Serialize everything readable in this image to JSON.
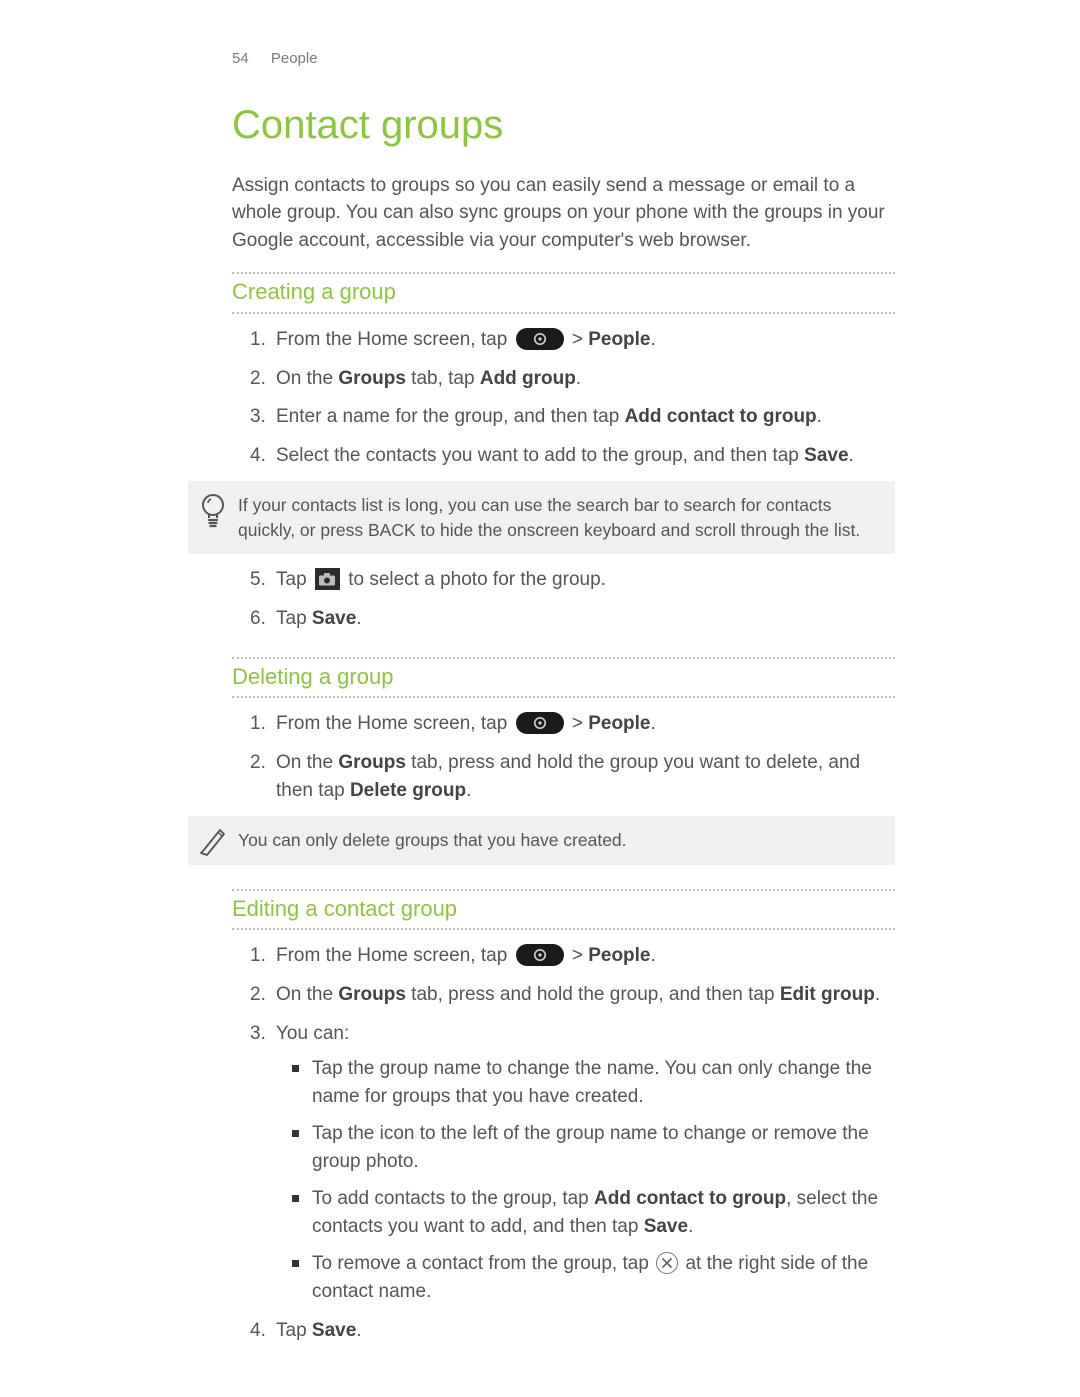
{
  "header": {
    "page_number": "54",
    "section": "People"
  },
  "title": "Contact groups",
  "intro": "Assign contacts to groups so you can easily send a message or email to a whole group. You can also sync groups on your phone with the groups in your Google account, accessible via your computer's web browser.",
  "sections": {
    "creating": {
      "heading": "Creating a group",
      "step1_a": "From the Home screen, tap ",
      "step1_b": " > ",
      "step1_people": "People",
      "step1_c": ".",
      "step2_a": "On the ",
      "step2_groups": "Groups",
      "step2_b": " tab, tap ",
      "step2_addgroup": "Add group",
      "step2_c": ".",
      "step3_a": "Enter a name for the group, and then tap ",
      "step3_add": "Add contact to group",
      "step3_b": ".",
      "step4_a": "Select the contacts you want to add to the group, and then tap ",
      "step4_save": "Save",
      "step4_b": ".",
      "tip": "If your contacts list is long, you can use the search bar to search for contacts quickly, or press BACK to hide the onscreen keyboard and scroll through the list.",
      "step5_a": "Tap ",
      "step5_b": " to select a photo for the group.",
      "step6_a": "Tap ",
      "step6_save": "Save",
      "step6_b": "."
    },
    "deleting": {
      "heading": "Deleting a group",
      "step1_a": "From the Home screen, tap ",
      "step1_b": " > ",
      "step1_people": "People",
      "step1_c": ".",
      "step2_a": "On the ",
      "step2_groups": "Groups",
      "step2_b": " tab, press and hold the group you want to delete, and then tap ",
      "step2_del": "Delete group",
      "step2_c": ".",
      "note": "You can only delete groups that you have created."
    },
    "editing": {
      "heading": "Editing a contact group",
      "step1_a": "From the Home screen, tap ",
      "step1_b": " > ",
      "step1_people": "People",
      "step1_c": ".",
      "step2_a": "On the ",
      "step2_groups": "Groups",
      "step2_b": " tab, press and hold the group, and then tap ",
      "step2_edit": "Edit group",
      "step2_c": ".",
      "step3": "You can:",
      "bullet1": "Tap the group name to change the name. You can only change the name for groups that you have created.",
      "bullet2": "Tap the icon to the left of the group name to change or remove the group photo.",
      "bullet3_a": "To add contacts to the group, tap ",
      "bullet3_add": "Add contact to group",
      "bullet3_b": ", select the contacts you want to add, and then tap ",
      "bullet3_save": "Save",
      "bullet3_c": ".",
      "bullet4_a": "To remove a contact from the group, tap ",
      "bullet4_b": " at the right side of the contact name.",
      "step4_a": "Tap ",
      "step4_save": "Save",
      "step4_b": "."
    }
  }
}
